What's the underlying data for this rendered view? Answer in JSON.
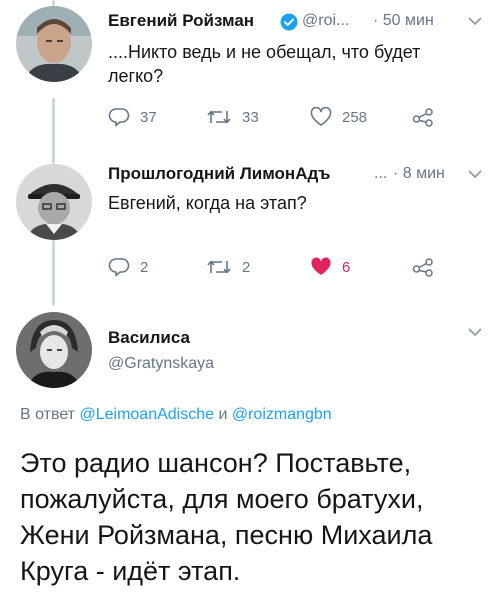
{
  "tweets": [
    {
      "name": "Евгений Ройзман",
      "verified": true,
      "handle": "@roi...",
      "time": "· 50 мин",
      "text": "....Никто ведь и не обещал, что будет легко?",
      "replies": "37",
      "retweets": "33",
      "likes": "258",
      "liked": false
    },
    {
      "name": "Прошлогодний ЛимонАдъ",
      "handle": "...",
      "time": "· 8 мин",
      "text": "Евгений, когда на этап?",
      "replies": "2",
      "retweets": "2",
      "likes": "6",
      "liked": true
    }
  ],
  "main_tweet": {
    "name": "Василиса",
    "handle": "@Gratynskaya",
    "reply_prefix": "В ответ",
    "mention_1": "@LeimoanAdische",
    "reply_joiner": "и",
    "mention_2": "@roizmangbn",
    "text": "Это радио шансон? Поставьте, пожалуйста, для моего братухи, Жени Ройзмана, песню Михаила Круга - идёт этап."
  },
  "colors": {
    "accent": "#1da1f2",
    "like": "#e0245e",
    "secondary_text": "#657786",
    "thread_line": "#ccd6dd"
  },
  "icons": [
    "reply-icon",
    "retweet-icon",
    "heart-icon",
    "share-icon",
    "verified-badge-icon",
    "chevron-down-icon"
  ]
}
